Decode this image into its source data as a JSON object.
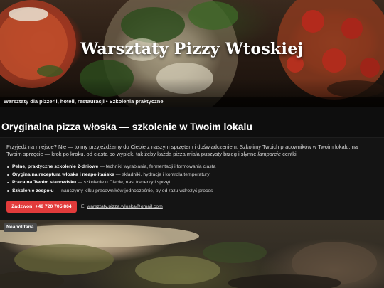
{
  "hero": {
    "title": "Warsztaty Pizzy Wtoskiej",
    "caption": "Warsztaty dla pizzerii, hoteli, restauracji • Szkolenia praktyczne"
  },
  "main": {
    "heading": "Oryginalna pizza włoska — szkolenie w Twoim lokalu",
    "intro_part1": "Przyjedź na miejsce? Nie — to my przyjeżdżamy do Ciebie z naszym sprzętem i doświadczeniem. Szkolimy Twoich pracowników w Twoim lokalu, na Twoim sprzęcie — krok po kroku, od ciasta po wypiek, tak żeby każda pizza miała puszysty brzeg i słynne ",
    "intro_em": "lamparcie",
    "intro_part2": " centki.",
    "features": [
      {
        "bold": "Pełne, praktyczne szkolenie 2-dniowe",
        "rest": " — techniki wyrabiania, fermentacji i formowania ciasta"
      },
      {
        "bold": "Oryginalna receptura włoska i neapolitańska",
        "rest": " — składniki, hydracja i kontrola temperatury"
      },
      {
        "bold": "Praca na Twoim stanowisku",
        "rest": " — szkolenie u Ciebie, nasi trenerzy i sprzęt"
      },
      {
        "bold": "Szkolenie zespołu",
        "rest": " — nauczymy kilku pracowników jednocześnie, by od razu wdrożyć proces"
      }
    ],
    "cta_label": "Zadzwoń: +48 720 705 864",
    "email_prefix": "E:",
    "email": "warsztaty.pizza.wloska@gmail.com"
  },
  "photo": {
    "label": "Neapolitana"
  },
  "colors": {
    "accent": "#e23b3b",
    "background": "#0e0e0e"
  }
}
